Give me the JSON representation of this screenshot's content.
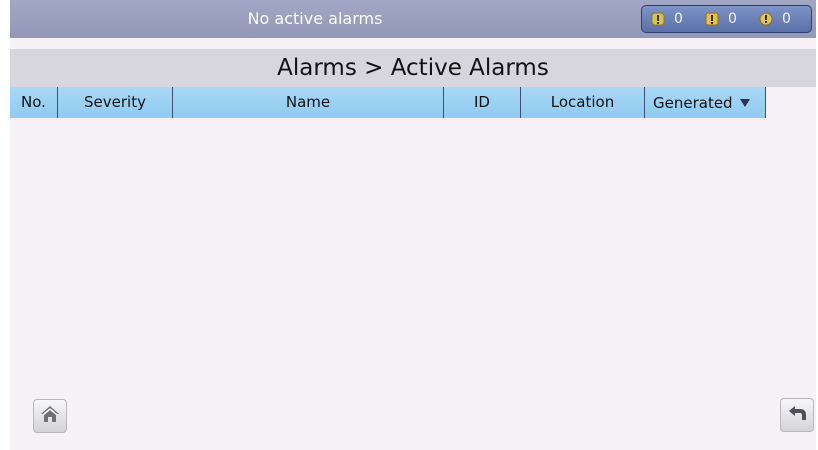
{
  "status_bar": {
    "message": "No active alarms",
    "counters": [
      {
        "icon": "minor-alarm-icon",
        "count": "0"
      },
      {
        "icon": "major-alarm-icon",
        "count": "0"
      },
      {
        "icon": "critical-alarm-icon",
        "count": "0"
      }
    ]
  },
  "page": {
    "title": "Alarms > Active Alarms"
  },
  "table": {
    "columns": [
      "No.",
      "Severity",
      "Name",
      "ID",
      "Location",
      "Generated"
    ],
    "sort_column": "Generated",
    "sort_direction": "descending",
    "rows": []
  },
  "nav": {
    "home_icon": "home-icon",
    "back_icon": "back-arrow-icon"
  }
}
